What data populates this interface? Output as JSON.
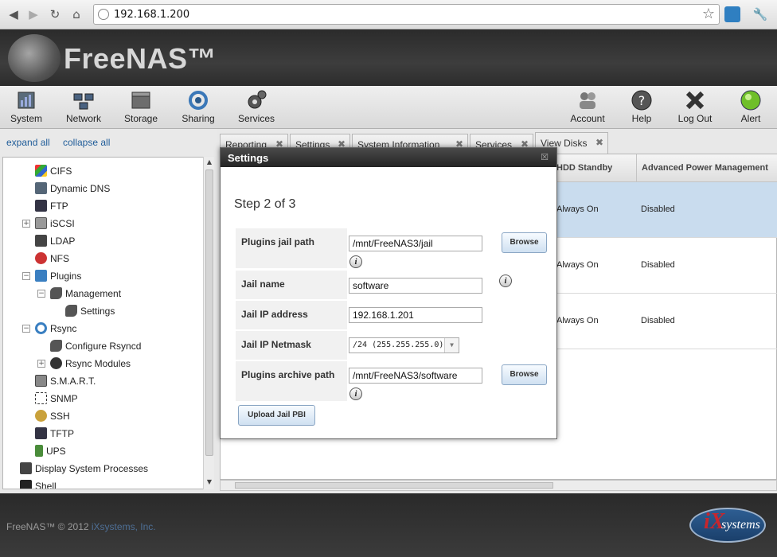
{
  "browser": {
    "url": "192.168.1.200"
  },
  "app": {
    "logo_text": "FreeNAS™"
  },
  "toolbar": {
    "left": [
      "System",
      "Network",
      "Storage",
      "Sharing",
      "Services"
    ],
    "right": [
      "Account",
      "Help",
      "Log Out",
      "Alert"
    ]
  },
  "sidebar": {
    "expand_all": "expand all",
    "collapse_all": "collapse all",
    "items": [
      {
        "label": "CIFS"
      },
      {
        "label": "Dynamic DNS"
      },
      {
        "label": "FTP"
      },
      {
        "label": "iSCSI"
      },
      {
        "label": "LDAP"
      },
      {
        "label": "NFS"
      },
      {
        "label": "Plugins"
      },
      {
        "label": "Management"
      },
      {
        "label": "Settings"
      },
      {
        "label": "Rsync"
      },
      {
        "label": "Configure Rsyncd"
      },
      {
        "label": "Rsync Modules"
      },
      {
        "label": "S.M.A.R.T."
      },
      {
        "label": "SNMP"
      },
      {
        "label": "SSH"
      },
      {
        "label": "TFTP"
      },
      {
        "label": "UPS"
      },
      {
        "label": "Display System Processes"
      },
      {
        "label": "Shell"
      }
    ]
  },
  "tabs": [
    "Reporting",
    "Settings",
    "System Information",
    "Services",
    "View Disks"
  ],
  "grid": {
    "columns": [
      "HDD Standby",
      "Advanced Power Management"
    ],
    "rows": [
      {
        "standby": "Always On",
        "apm": "Disabled"
      },
      {
        "standby": "Always On",
        "apm": "Disabled"
      },
      {
        "standby": "Always On",
        "apm": "Disabled"
      }
    ]
  },
  "dialog": {
    "title": "Settings",
    "step": "Step 2 of 3",
    "fields": {
      "jail_path": {
        "label": "Plugins jail path",
        "value": "/mnt/FreeNAS3/jail"
      },
      "jail_name": {
        "label": "Jail name",
        "value": "software"
      },
      "jail_ip": {
        "label": "Jail IP address",
        "value": "192.168.1.201"
      },
      "jail_netmask": {
        "label": "Jail IP Netmask",
        "value": "/24 (255.255.255.0)"
      },
      "archive_path": {
        "label": "Plugins archive path",
        "value": "/mnt/FreeNAS3/software"
      }
    },
    "browse_label": "Browse",
    "upload_label": "Upload Jail PBI"
  },
  "footer": {
    "copyright": "FreeNAS™ © 2012 ",
    "company": "iXsystems, Inc.",
    "logo_text": "systems",
    "logo_mark": "iX"
  }
}
